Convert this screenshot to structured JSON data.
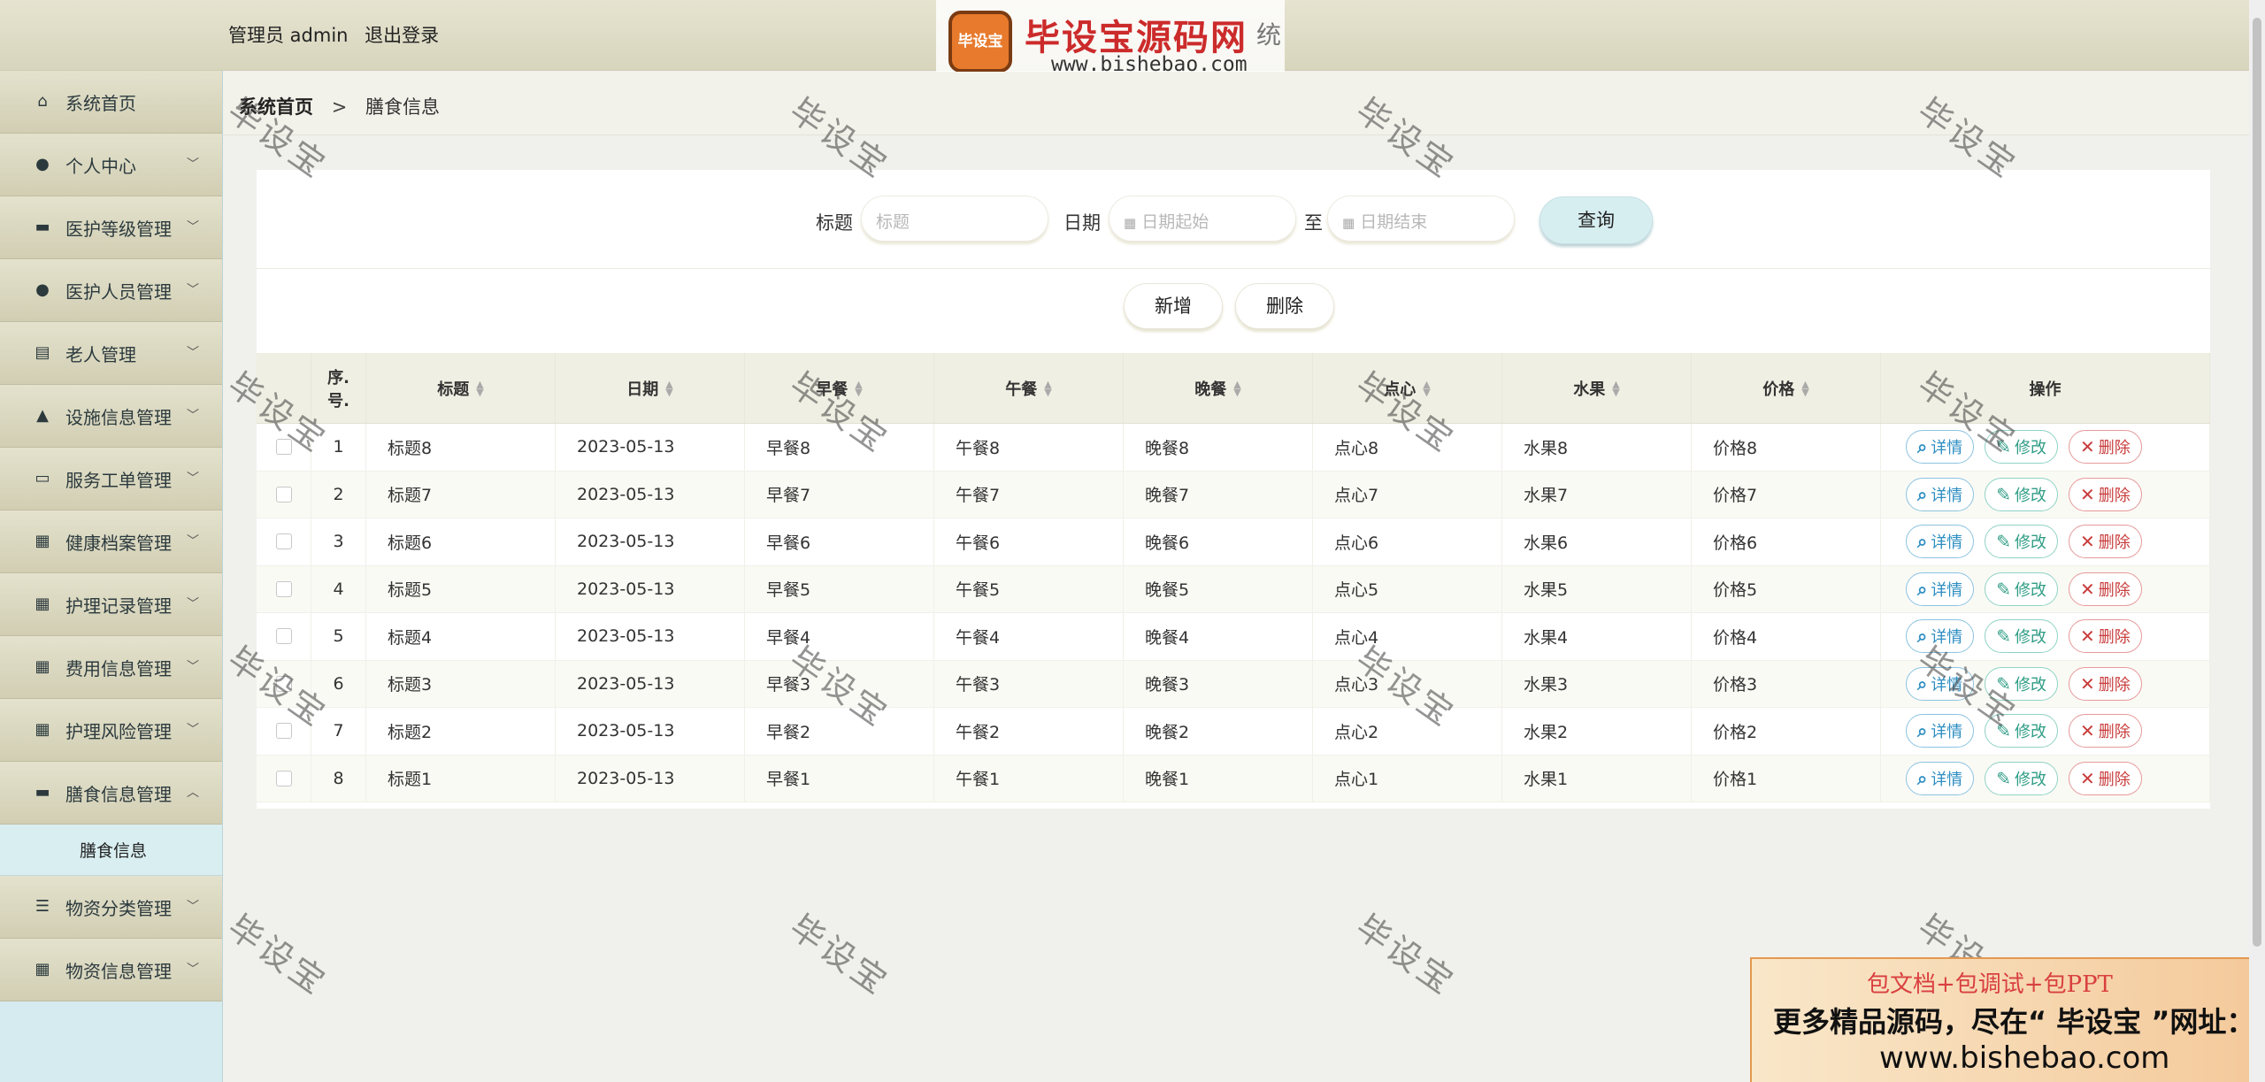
{
  "header": {
    "user_label": "管理员 admin",
    "logout": "退出登录",
    "brand_mark": "毕设宝",
    "brand_name": "毕设宝源码网",
    "brand_url": "www.bishebao.com",
    "brand_overflow": "统"
  },
  "sidebar": {
    "items": [
      {
        "label": "系统首页",
        "icon": "home-icon"
      },
      {
        "label": "个人中心",
        "icon": "user-icon"
      },
      {
        "label": "医护等级管理",
        "icon": "briefcase-icon"
      },
      {
        "label": "医护人员管理",
        "icon": "user-icon"
      },
      {
        "label": "老人管理",
        "icon": "clipboard-icon"
      },
      {
        "label": "设施信息管理",
        "icon": "person-icon"
      },
      {
        "label": "服务工单管理",
        "icon": "inbox-icon"
      },
      {
        "label": "健康档案管理",
        "icon": "grid-icon"
      },
      {
        "label": "护理记录管理",
        "icon": "grid-icon"
      },
      {
        "label": "费用信息管理",
        "icon": "grid-icon"
      },
      {
        "label": "护理风险管理",
        "icon": "grid-icon"
      },
      {
        "label": "膳食信息管理",
        "icon": "monitor-icon"
      },
      {
        "label": "物资分类管理",
        "icon": "list-icon"
      },
      {
        "label": "物资信息管理",
        "icon": "grid-icon"
      }
    ],
    "active_sub": "膳食信息"
  },
  "breadcrumb": {
    "home": "系统首页",
    "sep": ">",
    "current": "膳食信息"
  },
  "search": {
    "title_label": "标题",
    "title_placeholder": "标题",
    "date_label": "日期",
    "date_start": "日期起始",
    "to": "至",
    "date_end": "日期结束",
    "query": "查询"
  },
  "actions": {
    "add": "新增",
    "delete": "删除"
  },
  "table": {
    "columns": [
      "序号",
      "标题",
      "日期",
      "早餐",
      "午餐",
      "晚餐",
      "点心",
      "水果",
      "价格",
      "操作"
    ],
    "index_header_1": "序.",
    "index_header_2": "号.",
    "rows": [
      {
        "no": "1",
        "title": "标题8",
        "date": "2023-05-13",
        "breakfast": "早餐8",
        "lunch": "午餐8",
        "dinner": "晚餐8",
        "snack": "点心8",
        "fruit": "水果8",
        "price": "价格8"
      },
      {
        "no": "2",
        "title": "标题7",
        "date": "2023-05-13",
        "breakfast": "早餐7",
        "lunch": "午餐7",
        "dinner": "晚餐7",
        "snack": "点心7",
        "fruit": "水果7",
        "price": "价格7"
      },
      {
        "no": "3",
        "title": "标题6",
        "date": "2023-05-13",
        "breakfast": "早餐6",
        "lunch": "午餐6",
        "dinner": "晚餐6",
        "snack": "点心6",
        "fruit": "水果6",
        "price": "价格6"
      },
      {
        "no": "4",
        "title": "标题5",
        "date": "2023-05-13",
        "breakfast": "早餐5",
        "lunch": "午餐5",
        "dinner": "晚餐5",
        "snack": "点心5",
        "fruit": "水果5",
        "price": "价格5"
      },
      {
        "no": "5",
        "title": "标题4",
        "date": "2023-05-13",
        "breakfast": "早餐4",
        "lunch": "午餐4",
        "dinner": "晚餐4",
        "snack": "点心4",
        "fruit": "水果4",
        "price": "价格4"
      },
      {
        "no": "6",
        "title": "标题3",
        "date": "2023-05-13",
        "breakfast": "早餐3",
        "lunch": "午餐3",
        "dinner": "晚餐3",
        "snack": "点心3",
        "fruit": "水果3",
        "price": "价格3"
      },
      {
        "no": "7",
        "title": "标题2",
        "date": "2023-05-13",
        "breakfast": "早餐2",
        "lunch": "午餐2",
        "dinner": "晚餐2",
        "snack": "点心2",
        "fruit": "水果2",
        "price": "价格2"
      },
      {
        "no": "8",
        "title": "标题1",
        "date": "2023-05-13",
        "breakfast": "早餐1",
        "lunch": "午餐1",
        "dinner": "晚餐1",
        "snack": "点心1",
        "fruit": "水果1",
        "price": "价格1"
      }
    ],
    "op_detail": "详情",
    "op_edit": "修改",
    "op_delete": "删除"
  },
  "watermark": "毕设宝",
  "ad": {
    "line1": "包文档+包调试+包PPT",
    "line2": "更多精品源码，尽在“ 毕设宝 ”网址：",
    "line3": "www.bishebao.com"
  },
  "colors": {
    "accent_header": "#d8d5bd",
    "sidebar_bg": "#d5ebef",
    "query_btn": "#d7eef1",
    "delete_red": "#c93c3c",
    "detail_blue": "#2e8ec2",
    "edit_green": "#2f9d86"
  }
}
